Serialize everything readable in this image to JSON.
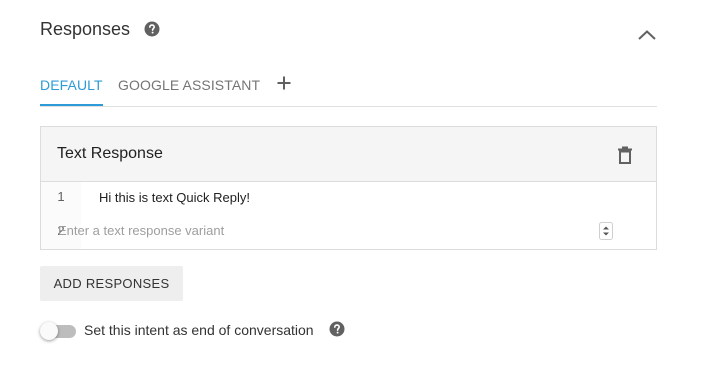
{
  "header": {
    "title": "Responses",
    "help_icon": "help-circle-icon",
    "collapse_icon": "chevron-up-icon"
  },
  "tabs": [
    {
      "label": "DEFAULT",
      "active": true
    },
    {
      "label": "GOOGLE ASSISTANT",
      "active": false
    }
  ],
  "add_tab_icon": "plus-icon",
  "card": {
    "title": "Text Response",
    "delete_icon": "trash-icon",
    "rows": [
      {
        "number": "1",
        "text": "Hi this is text Quick Reply!"
      },
      {
        "number": "2",
        "value": "",
        "placeholder": "Enter a text response variant"
      }
    ]
  },
  "add_responses_label": "ADD RESPONSES",
  "end_conversation": {
    "label": "Set this intent as end of conversation",
    "enabled": false
  },
  "colors": {
    "accent": "#2d9bd7",
    "muted_text": "#757575",
    "icon": "#616161"
  }
}
